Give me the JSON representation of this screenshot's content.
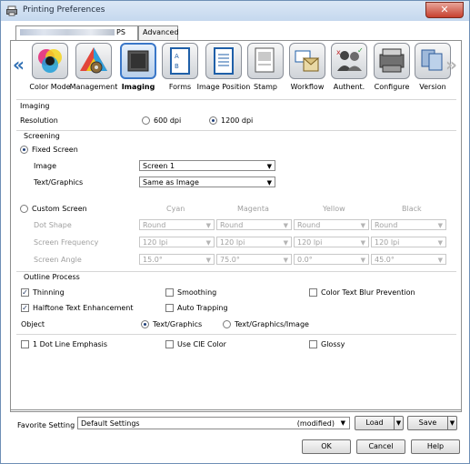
{
  "window": {
    "title": "Printing Preferences",
    "close": "✕"
  },
  "tabs": {
    "ps_suffix": "PS",
    "advanced": "Advanced"
  },
  "iconbar": {
    "items": [
      {
        "label": "Color Mode"
      },
      {
        "label": "Management"
      },
      {
        "label": "Imaging",
        "active": true
      },
      {
        "label": "Forms"
      },
      {
        "label": "Image Position"
      },
      {
        "label": "Stamp"
      },
      {
        "label": "Workflow"
      },
      {
        "label": "Authent."
      },
      {
        "label": "Configure"
      },
      {
        "label": "Version"
      }
    ],
    "left_arrow": "«",
    "right_arrow": "»"
  },
  "imaging": {
    "section_title": "Imaging",
    "resolution_label": "Resolution",
    "res_600": "600 dpi",
    "res_1200": "1200 dpi",
    "selected_resolution": "1200 dpi"
  },
  "screening": {
    "section_title": "Screening",
    "fixed_screen": "Fixed Screen",
    "image_label": "Image",
    "image_value": "Screen 1",
    "textgraphics_label": "Text/Graphics",
    "textgraphics_value": "Same as Image",
    "custom_screen": "Custom Screen",
    "columns": [
      "Cyan",
      "Magenta",
      "Yellow",
      "Black"
    ],
    "rows": [
      {
        "label": "Dot Shape",
        "values": [
          "Round",
          "Round",
          "Round",
          "Round"
        ]
      },
      {
        "label": "Screen Frequency",
        "values": [
          "120 lpi",
          "120 lpi",
          "120 lpi",
          "120 lpi"
        ]
      },
      {
        "label": "Screen Angle",
        "values": [
          "15.0°",
          "75.0°",
          "0.0°",
          "45.0°"
        ]
      }
    ]
  },
  "outline": {
    "section_title": "Outline Process",
    "thinning": "Thinning",
    "smoothing": "Smoothing",
    "color_text_blur": "Color Text Blur Prevention",
    "halftone_text": "Halftone Text Enhancement",
    "auto_trapping": "Auto Trapping",
    "object_label": "Object",
    "obj_textgraphics": "Text/Graphics",
    "obj_textgraphicsimage": "Text/Graphics/Image",
    "dot_line": "1 Dot Line Emphasis",
    "cie_color": "Use CIE Color",
    "glossy": "Glossy"
  },
  "favorite": {
    "label": "Favorite Setting",
    "value": "Default Settings",
    "modified": "(modified)",
    "load": "Load",
    "save": "Save"
  },
  "footer": {
    "ok": "OK",
    "cancel": "Cancel",
    "help": "Help"
  },
  "colors": {
    "accent": "#3a77c8",
    "close_red": "#c7402e"
  }
}
